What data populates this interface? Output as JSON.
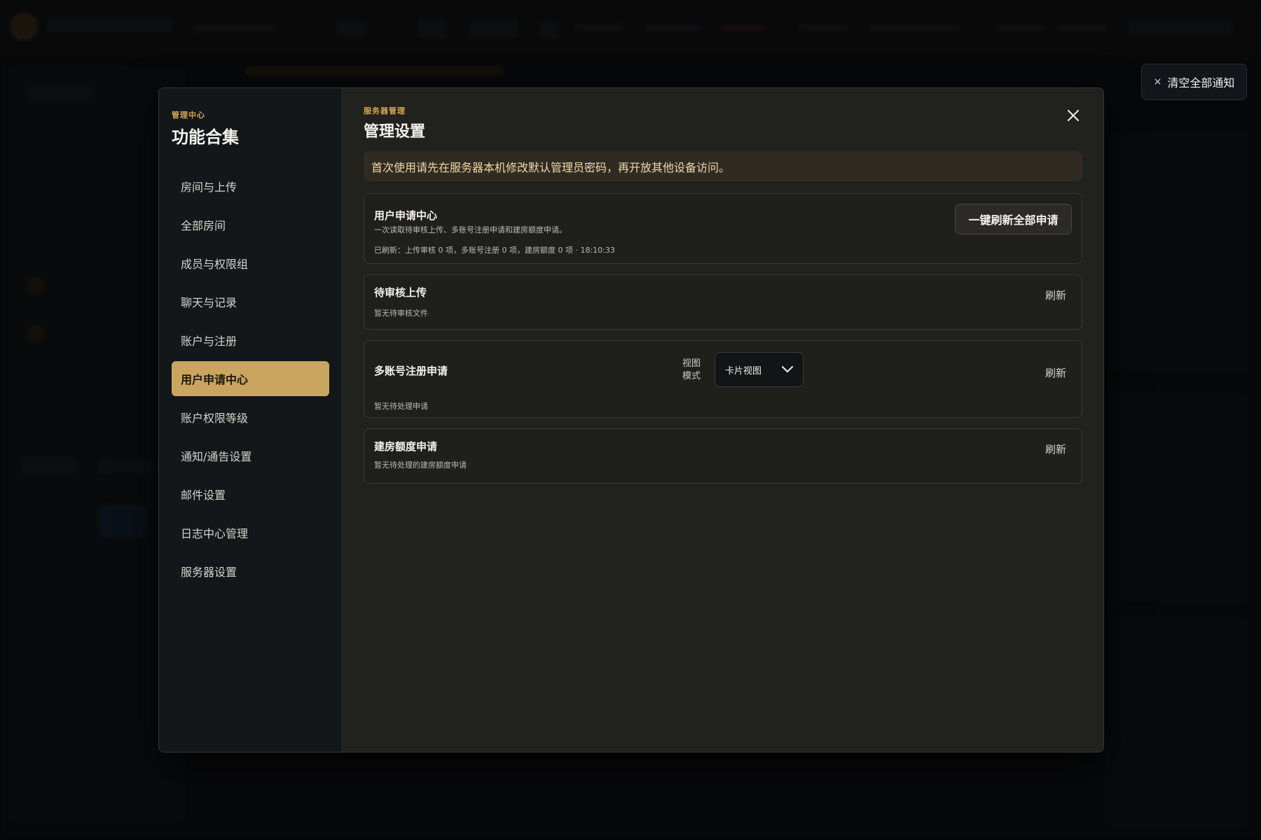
{
  "notifications": {
    "clear_icon": "×",
    "clear_label": "清空全部通知"
  },
  "sidebar": {
    "kicker": "管理中心",
    "title": "功能合集",
    "items": [
      {
        "label": "房间与上传"
      },
      {
        "label": "全部房间"
      },
      {
        "label": "成员与权限组"
      },
      {
        "label": "聊天与记录"
      },
      {
        "label": "账户与注册"
      },
      {
        "label": "用户申请中心",
        "active": true
      },
      {
        "label": "账户权限等级"
      },
      {
        "label": "通知/通告设置"
      },
      {
        "label": "邮件设置"
      },
      {
        "label": "日志中心管理"
      },
      {
        "label": "服务器设置"
      }
    ]
  },
  "main": {
    "kicker": "服务器管理",
    "title": "管理设置",
    "notice": "首次使用请先在服务器本机修改默认管理员密码，再开放其他设备访问。",
    "summary": {
      "title": "用户申请中心",
      "subtitle": "一次读取待审核上传、多账号注册申请和建房额度申请。",
      "meta": "已刷新：上传审核 0 项，多账号注册 0 项，建房额度 0 项 · 18:10:33",
      "refresh_all_label": "一键刷新全部申请"
    },
    "pending_upload": {
      "title": "待审核上传",
      "empty": "暂无待审核文件",
      "refresh_label": "刷新"
    },
    "multi_account": {
      "title": "多账号注册申请",
      "empty": "暂无待处理申请",
      "view_mode_label": "视图模式",
      "view_mode_value": "卡片视图",
      "refresh_label": "刷新"
    },
    "room_quota": {
      "title": "建房额度申请",
      "empty": "暂无待处理的建房额度申请",
      "refresh_label": "刷新"
    }
  },
  "colors": {
    "accent": "#c9a55f",
    "kicker": "#d6a94f",
    "notice_bg": "#302b22"
  }
}
